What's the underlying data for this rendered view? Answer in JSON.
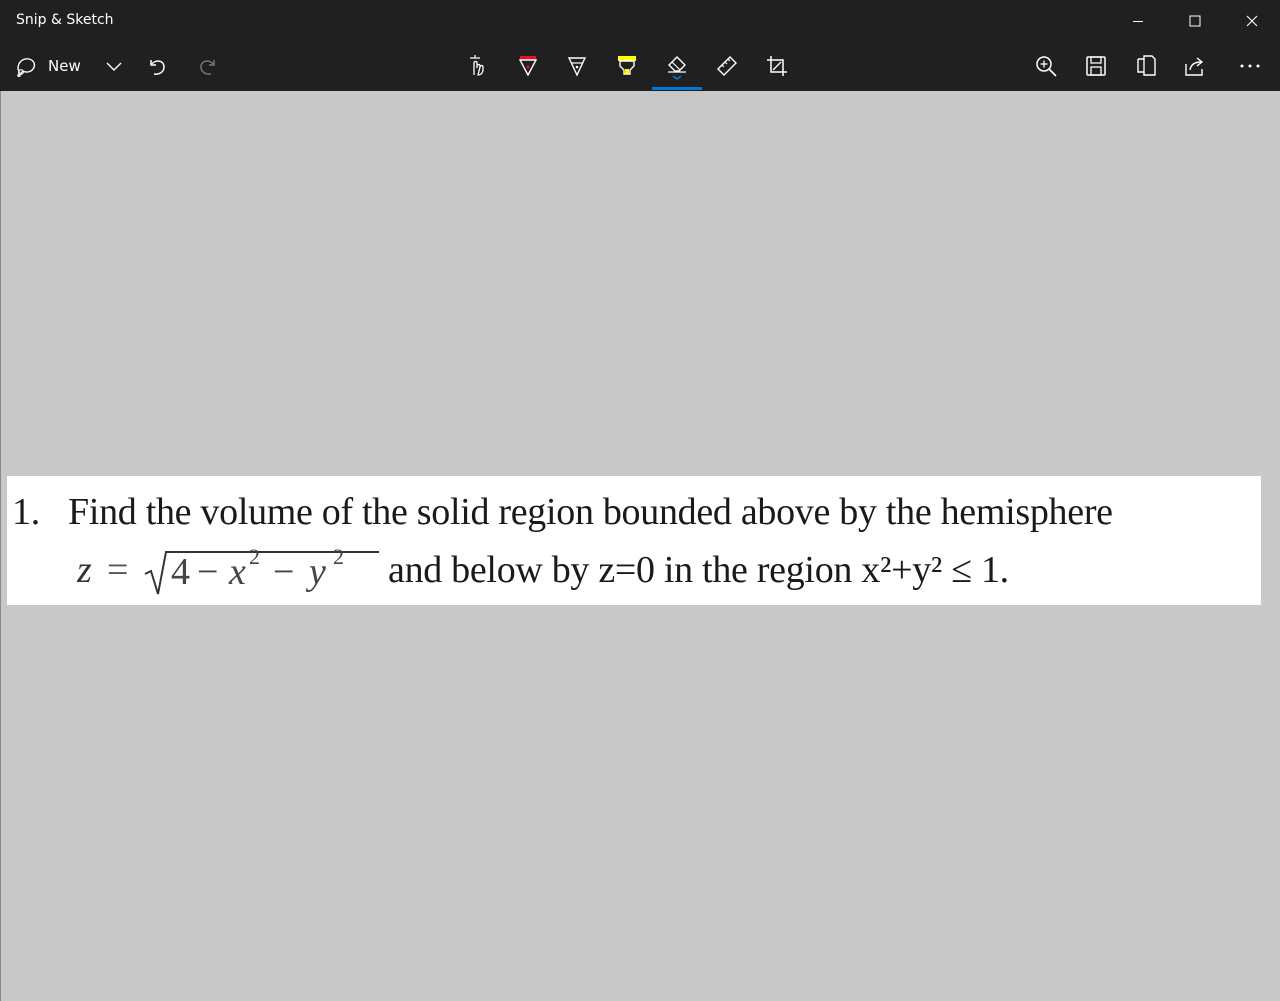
{
  "window": {
    "title": "Snip & Sketch"
  },
  "toolbar": {
    "new_label": "New",
    "tools": [
      "touch-writing-icon",
      "ballpoint-pen-icon",
      "pencil-icon",
      "highlighter-icon",
      "eraser-icon",
      "ruler-icon",
      "crop-icon"
    ],
    "actions": [
      "zoom-in-icon",
      "save-icon",
      "copy-icon",
      "share-icon",
      "more-icon"
    ],
    "active_tool": "eraser-icon"
  },
  "colors": {
    "chrome": "#202020",
    "canvas": "#c8c8c8",
    "accent": "#0078d7",
    "pen_red": "#e81123",
    "highlighter_yellow": "#ffff00"
  },
  "snip": {
    "problem_number": "1.",
    "line1_text": "Find the volume of the solid region bounded above by the hemisphere",
    "equation_lhs": "z =",
    "equation_radicand": "4 − x² − y²",
    "line2_text": "and below by z=0 in the region x²+y² ≤ 1."
  }
}
